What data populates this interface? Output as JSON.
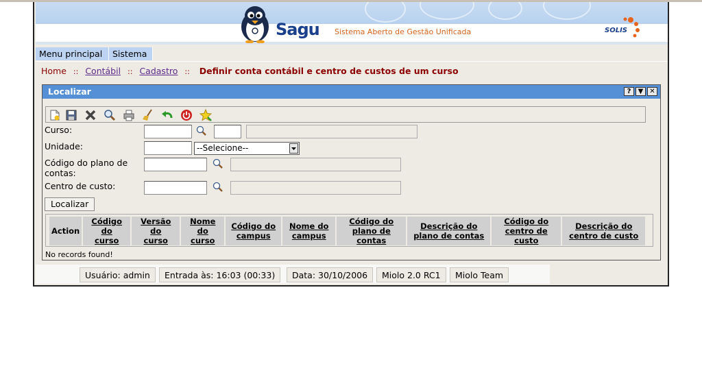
{
  "header": {
    "logo_text": "Sagu",
    "subtitle": "Sistema Aberto de Gestão Unificada",
    "partner_logo": "SOLIS"
  },
  "menu": {
    "items": [
      {
        "label": "Menu principal"
      },
      {
        "label": "Sistema"
      }
    ]
  },
  "breadcrumb": {
    "home": "Home",
    "items": [
      "Contábil",
      "Cadastro"
    ],
    "separator": "::",
    "current": "Definir conta contábil e centro de custos de um curso"
  },
  "panel": {
    "title": "Localizar",
    "window_buttons": [
      "?",
      "▼",
      "✕"
    ],
    "toolbar_icons": [
      "new-document-icon",
      "save-icon",
      "delete-icon",
      "search-icon",
      "print-icon",
      "clear-broom-icon",
      "back-arrow-icon",
      "exit-power-icon",
      "favorite-star-icon"
    ],
    "form": {
      "curso_label": "Curso:",
      "unidade_label": "Unidade:",
      "unidade_selected": "--Selecione--",
      "codigo_plano_label_line1": "Código do plano de",
      "codigo_plano_label_line2": "contas:",
      "centro_custo_label": "Centro de custo:",
      "submit_label": "Localizar"
    },
    "grid": {
      "columns": [
        {
          "line1": "Action",
          "line2": ""
        },
        {
          "line1": "Código do",
          "line2": "curso"
        },
        {
          "line1": "Versão do",
          "line2": "curso"
        },
        {
          "line1": "Nome do",
          "line2": "curso"
        },
        {
          "line1": "Código do",
          "line2": "campus"
        },
        {
          "line1": "Nome do",
          "line2": "campus"
        },
        {
          "line1": "Código do",
          "line2": "plano de",
          "line3": "contas"
        },
        {
          "line1": "Descrição do",
          "line2": "plano de contas"
        },
        {
          "line1": "Código do",
          "line2": "centro de custo"
        },
        {
          "line1": "Descrição do",
          "line2": "centro de custo"
        }
      ],
      "empty_message": "No records found!"
    }
  },
  "status": {
    "user": "Usuário: admin",
    "entry": "Entrada às: 16:03 (00:33)",
    "date": "Data: 30/10/2006",
    "version": "Miolo 2.0 RC1",
    "team": "Miolo Team"
  },
  "colors": {
    "title_bar": "#5590d6",
    "menu_bg": "#bcd3f2",
    "breadcrumb": "#8b0000",
    "panel_bg": "#eeeae4"
  }
}
